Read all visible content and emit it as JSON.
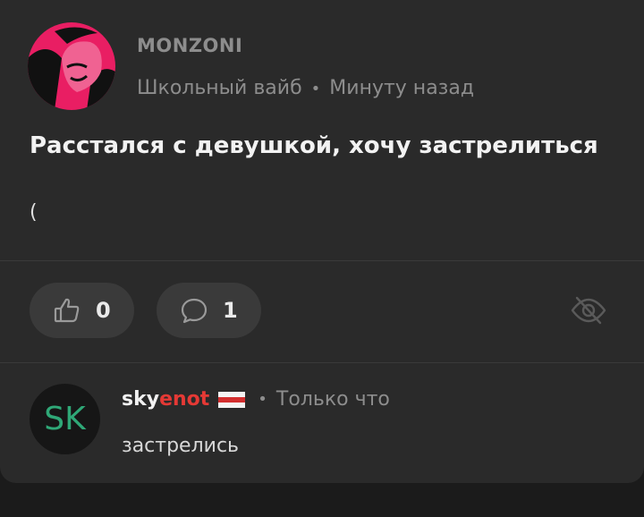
{
  "post": {
    "author": "MONZONI",
    "community": "Школьный вайб",
    "separator": "•",
    "time": "Минуту назад",
    "title": "Расстался с девушкой, хочу застрелиться",
    "body": "("
  },
  "actions": {
    "likes": "0",
    "comments": "1"
  },
  "comment": {
    "avatar_initials": "SK",
    "username_part1": "sky",
    "username_part2": "enot",
    "separator": "•",
    "time": "Только что",
    "text": "застрелись"
  },
  "colors": {
    "background": "#1b1b1b",
    "card": "#2a2a2a",
    "pill": "#3a3a3a",
    "muted": "#8d8d8d",
    "accent_red": "#e53935",
    "avatar_text": "#2fa877",
    "avatar_pink": "#e91e63"
  },
  "icons": [
    "thumbs-up-icon",
    "comment-bubble-icon",
    "eye-off-icon",
    "flag-icon"
  ]
}
